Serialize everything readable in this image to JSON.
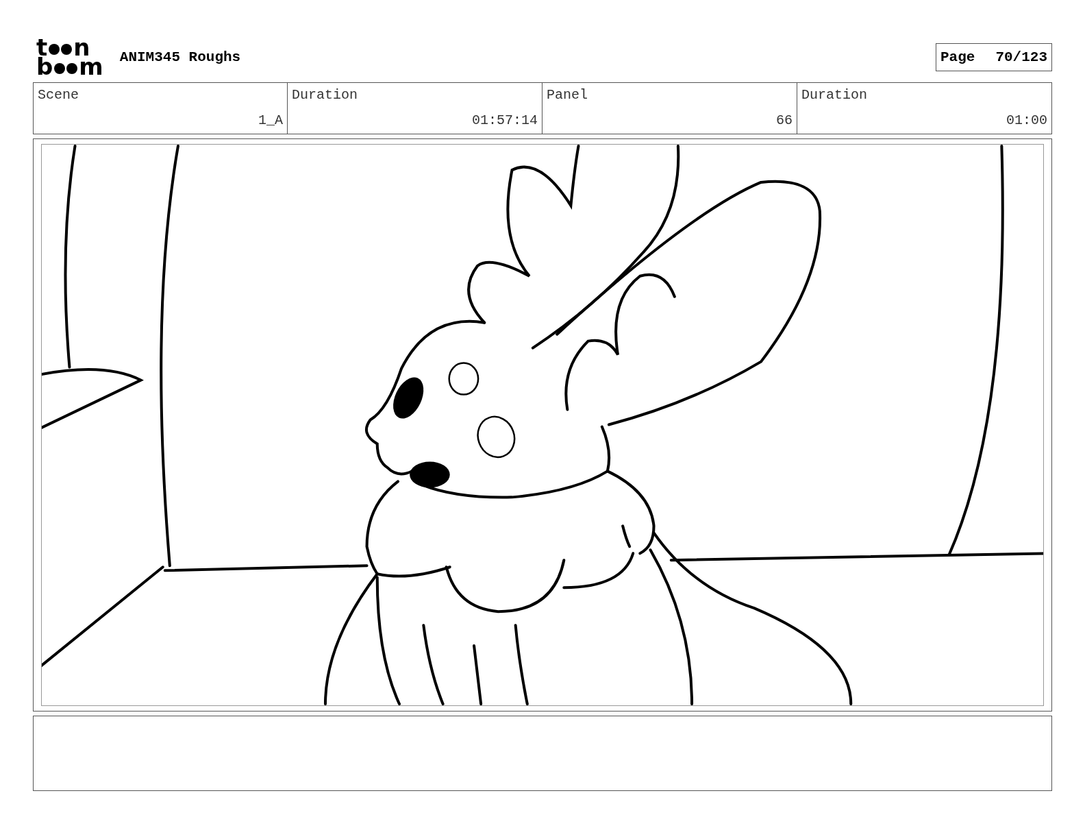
{
  "logo": [
    [
      "t",
      "n"
    ],
    [
      "b",
      "m"
    ]
  ],
  "title": "ANIM345 Roughs",
  "page": {
    "label": "Page",
    "number": "70/123"
  },
  "info_table": {
    "columns": [
      "Scene",
      "Duration",
      "Panel",
      "Duration"
    ],
    "row": [
      "1_A",
      "01:57:14",
      "66",
      "01:00"
    ]
  }
}
